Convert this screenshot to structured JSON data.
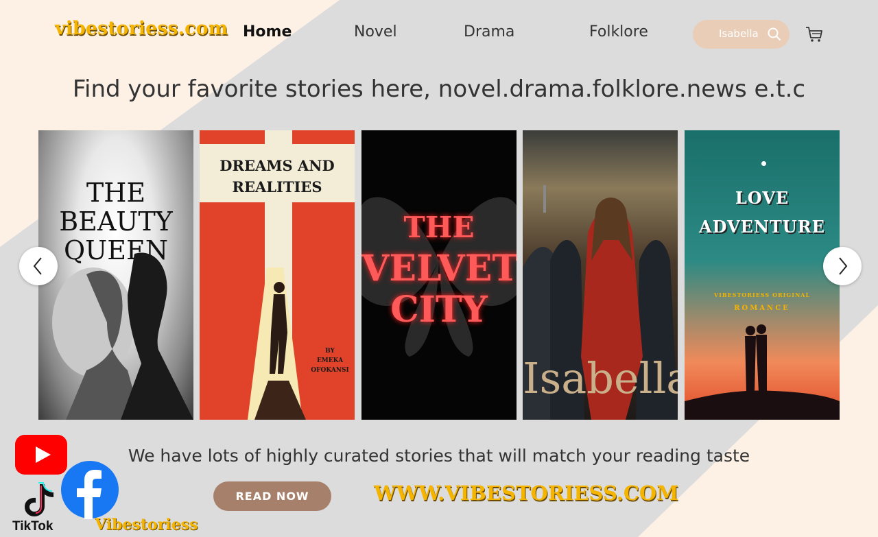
{
  "header": {
    "logo": "vibestoriess.com",
    "nav": [
      {
        "label": "Home",
        "active": true
      },
      {
        "label": "Novel",
        "active": false
      },
      {
        "label": "Drama",
        "active": false
      },
      {
        "label": "Folklore",
        "active": false
      }
    ],
    "search": {
      "value": "Isabella",
      "icon": "search-icon"
    },
    "cart_icon": "cart-icon"
  },
  "hero": {
    "tagline": "Find your favorite stories here, novel.drama.folklore.news e.t.c"
  },
  "carousel": {
    "cards": [
      {
        "title_lines": [
          "THE BEAUTY",
          "QUEEN"
        ]
      },
      {
        "title_lines": [
          "DREAMS AND",
          "REALITIES"
        ],
        "author_lines": [
          "BY",
          "EMEKA",
          "OFOKANSI"
        ]
      },
      {
        "title_lines": [
          "THE",
          "VELVET",
          "CITY"
        ]
      },
      {
        "title_lines": [
          "Isabella"
        ]
      },
      {
        "title_lines": [
          "LOVE",
          "ADVENTURE"
        ],
        "sub_lines": [
          "VIBESTORIESS ORIGINAL",
          "ROMANCE"
        ]
      }
    ],
    "prev_icon": "chevron-left-icon",
    "next_icon": "chevron-right-icon"
  },
  "bottom": {
    "tagline": "We have lots of highly curated stories that will match your reading taste",
    "read_button": "READ NOW",
    "site_url": "WWW.VIBESTORIESS.COM",
    "social_name": "Vibestoriess",
    "tiktok_label": "TikTok"
  },
  "colors": {
    "accent_gold": "#f4b400",
    "button_brown": "#a6806b",
    "search_bg": "#eacdb7",
    "page_bg": "#fdf1e6",
    "diag_bg": "#dcdcdc"
  }
}
